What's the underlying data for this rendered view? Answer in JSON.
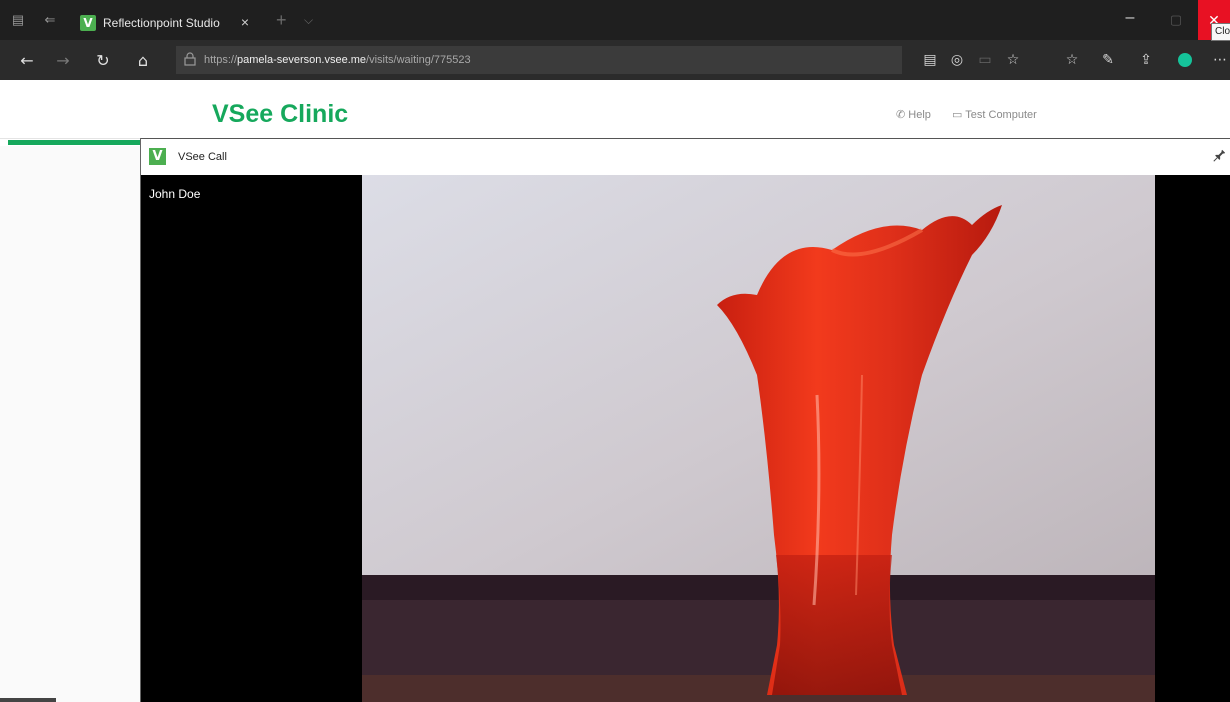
{
  "browser": {
    "tab": {
      "title": "Reflectionpoint Studio",
      "close_glyph": "×",
      "favicon_letter": "V"
    },
    "new_tab_glyph": "+",
    "tab_list_glyph": "⌵",
    "window": {
      "minimize_glyph": "–",
      "maximize_glyph": "▢",
      "close_glyph": "✕",
      "close_tooltip": "Clo"
    },
    "nav": {
      "back_glyph": "←",
      "forward_glyph": "→",
      "refresh_glyph": "↻",
      "home_glyph": "⌂"
    },
    "address": {
      "scheme": "https://",
      "host": "pamela-severson.vsee.me",
      "path": "/visits/waiting/775523",
      "lock_glyph": "🔒"
    },
    "toolbar_icons": [
      "reading-view-icon",
      "extension-icon",
      "reading-list-icon",
      "favorite-star-icon",
      "favorites-hub-icon",
      "pen-notes-icon",
      "share-icon",
      "grammarly-icon",
      "more-icon"
    ],
    "toolbar_glyphs": {
      "reading_view": "▤",
      "extension": "◎",
      "reading_list": "▭",
      "favorite": "☆",
      "favorites_hub": "☆",
      "pen": "✎",
      "share": "⇪",
      "more": "⋯"
    }
  },
  "site": {
    "brand": "VSee Clinic",
    "brand_color": "#16a85c",
    "help": {
      "glyph": "✆",
      "label": "Help"
    },
    "test_computer": {
      "glyph": "▭",
      "label": "Test Computer"
    }
  },
  "call": {
    "window_title": "VSee Call",
    "logo_letter": "V",
    "pin_glyph": "📌",
    "caller_name": "John Doe"
  }
}
